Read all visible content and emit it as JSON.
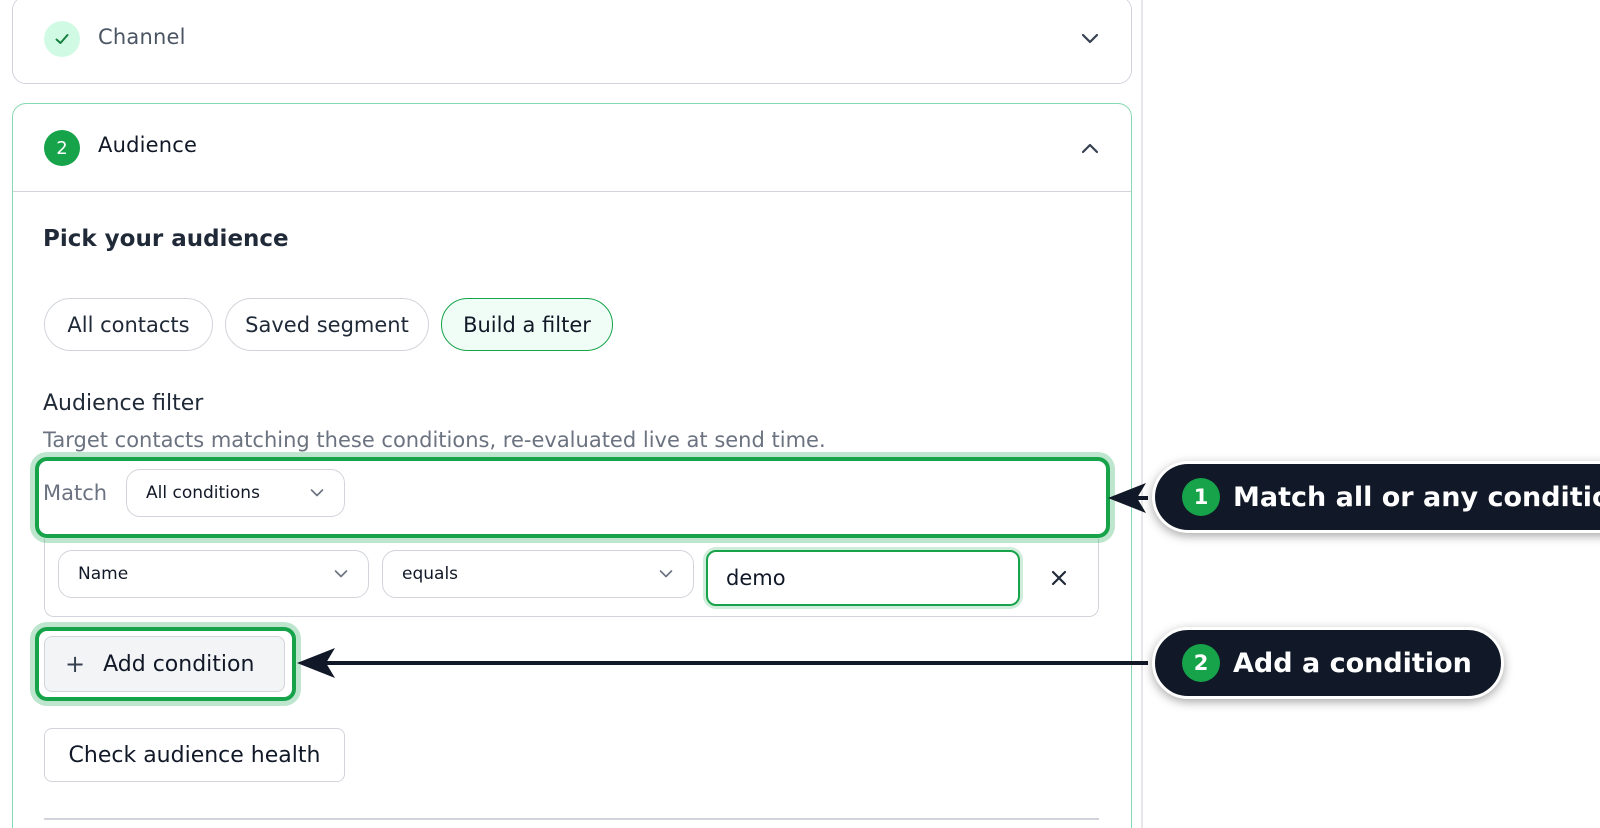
{
  "channel_card": {
    "title": "Channel",
    "status_icon": "check-icon",
    "toggle_icon": "chevron-down-icon"
  },
  "audience_card": {
    "step_number": "2",
    "title": "Audience",
    "toggle_icon": "chevron-up-icon",
    "section_title": "Pick your audience",
    "options": [
      {
        "label": "All contacts",
        "selected": false
      },
      {
        "label": "Saved segment",
        "selected": false
      },
      {
        "label": "Build a filter",
        "selected": true
      }
    ],
    "filter": {
      "title": "Audience filter",
      "subtitle": "Target contacts matching these conditions, re-evaluated live at send time.",
      "match_label": "Match",
      "match_value": "All conditions",
      "condition": {
        "field": "Name",
        "operator": "equals",
        "value": "demo"
      },
      "add_condition_label": "Add condition",
      "add_condition_icon": "plus-icon"
    },
    "health_button_label": "Check audience health"
  },
  "callouts": [
    {
      "number": "1",
      "text": "Match all or any conditions"
    },
    {
      "number": "2",
      "text": "Add a condition"
    }
  ],
  "colors": {
    "accent": "#16a34a",
    "callout_bg": "#111827",
    "accent_soft": "#d1fae5"
  }
}
